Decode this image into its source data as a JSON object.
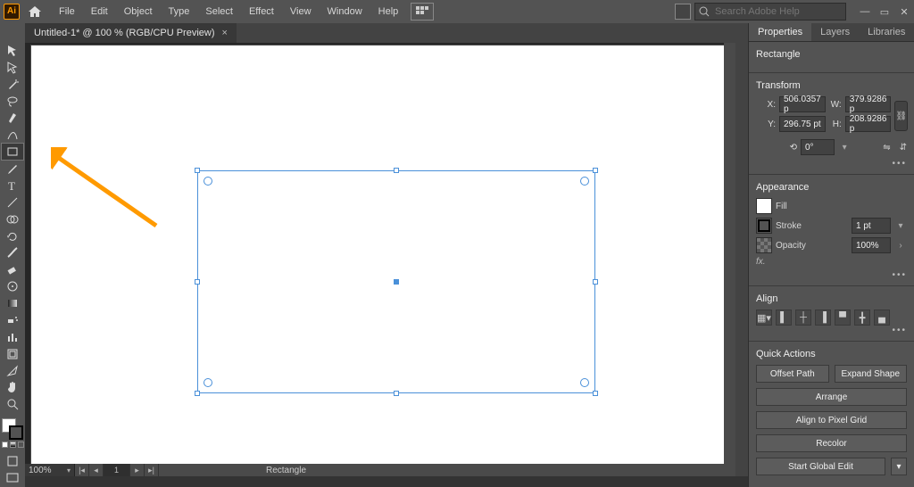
{
  "app": {
    "badge": "Ai"
  },
  "menu": {
    "items": [
      "File",
      "Edit",
      "Object",
      "Type",
      "Select",
      "Effect",
      "View",
      "Window",
      "Help"
    ]
  },
  "search": {
    "placeholder": "Search Adobe Help"
  },
  "tab": {
    "title": "Untitled-1* @ 100 % (RGB/CPU Preview)"
  },
  "toolbox": {
    "tools": [
      "selection",
      "direct-selection",
      "pen",
      "curvature",
      "magic-wand",
      "lasso",
      "rectangle",
      "paintbrush",
      "type",
      "line-segment",
      "shape-builder",
      "rotate",
      "width",
      "eraser",
      "eyedropper",
      "gradient",
      "symbol-sprayer",
      "column-graph",
      "artboard",
      "slice",
      "hand",
      "zoom"
    ],
    "selected_index": 6
  },
  "statusbar": {
    "zoom": "100%",
    "page": "1",
    "tool_label": "Rectangle"
  },
  "panel": {
    "tabs": [
      "Properties",
      "Layers",
      "Libraries"
    ],
    "object_type": "Rectangle",
    "sections": {
      "transform": {
        "title": "Transform",
        "x": "506.0357 p",
        "y": "296.75 pt",
        "w": "379.9286 p",
        "h": "208.9286 p",
        "rotate": "0°"
      },
      "appearance": {
        "title": "Appearance",
        "fill_label": "Fill",
        "stroke_label": "Stroke",
        "stroke_value": "1 pt",
        "opacity_label": "Opacity",
        "opacity_value": "100%",
        "fx": "fx."
      },
      "align": {
        "title": "Align"
      },
      "quick_actions": {
        "title": "Quick Actions",
        "buttons": [
          "Offset Path",
          "Expand Shape",
          "Arrange",
          "Align to Pixel Grid",
          "Recolor",
          "Start Global Edit"
        ]
      }
    }
  }
}
